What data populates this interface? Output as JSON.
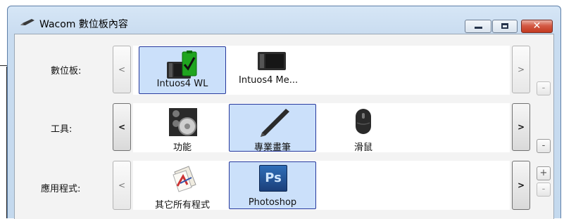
{
  "window": {
    "title": "Wacom 數位板內容",
    "controls": {
      "minimize": "minimize",
      "maximize": "maximize",
      "close": "✕"
    }
  },
  "rows": {
    "tablet": {
      "label": "數位板:",
      "scroll_left": "<",
      "scroll_right": ">",
      "remove_button": "-",
      "items": [
        {
          "label": "Intuos4 WL",
          "icon": "tablet-wireless-check-icon",
          "selected": true
        },
        {
          "label": "Intuos4 Me...",
          "icon": "tablet-icon",
          "selected": false
        }
      ]
    },
    "tool": {
      "label": "工具:",
      "scroll_left": "<",
      "scroll_right": ">",
      "remove_button": "-",
      "items": [
        {
          "label": "功能",
          "icon": "functions-icon",
          "selected": false
        },
        {
          "label": "專業畫筆",
          "icon": "pen-icon",
          "selected": true
        },
        {
          "label": "滑鼠",
          "icon": "mouse-icon",
          "selected": false
        }
      ]
    },
    "application": {
      "label": "應用程式:",
      "scroll_left": "<",
      "scroll_right": ">",
      "add_button": "+",
      "remove_button": "-",
      "items": [
        {
          "label": "其它所有程式",
          "icon": "all-programs-icon",
          "selected": false
        },
        {
          "label": "Photoshop",
          "icon": "photoshop-icon",
          "icon_text": "Ps",
          "selected": true
        }
      ]
    }
  }
}
